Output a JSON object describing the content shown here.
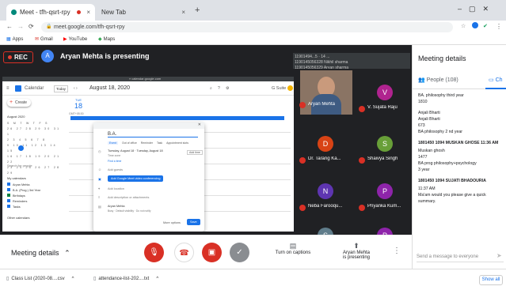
{
  "browser": {
    "tabs": [
      {
        "title": "Meet - tfh-qsrt-rpy",
        "close": "×"
      },
      {
        "title": "New Tab",
        "close": "×"
      }
    ],
    "new_tab": "+",
    "address": "meet.google.com/tfh-qsrt-rpy",
    "bookmarks": [
      "Apps",
      "Gmail",
      "YouTube",
      "Maps"
    ]
  },
  "meet": {
    "rec_label": "REC",
    "presenter_initial": "A",
    "presenter_text": "Aryan Mehta is presenting",
    "caption_overlay": "11901494...5 · 14 ...\n1190145056328 Nikhil sharma\n1190145056329 Aryan sharma",
    "shared_screen": {
      "browser_top": "» calendar.google.com",
      "app_name": "Calendar",
      "today_btn": "Today",
      "date_title": "August 18, 2020",
      "suite": "G Suite",
      "create_label": "Create",
      "mini_month": "August 2020",
      "day_label": "TUE",
      "day_num": "18",
      "timezone": "GMT+05:30",
      "search_people": "Search for people",
      "my_calendars_label": "My calendars",
      "my_calendars": [
        "Aryan Mehta",
        "B.A. (Prog.) 3rd Year",
        "Birthdays",
        "Reminders",
        "Tasks"
      ],
      "other_calendars_label": "Other calendars",
      "dialog": {
        "title": "B.A.",
        "tabs": [
          "Event",
          "Out of office",
          "Reminder",
          "Task",
          "Appointment slots"
        ],
        "date_line": "Tuesday, August 18  ·  Tuesday, August 18",
        "time_zone": "Time zone",
        "find_time": "Find a time",
        "add_guests": "Add guests",
        "meet_button": "Add Google Meet video conferencing",
        "add_location": "Add location",
        "add_description": "Add description or attachments",
        "owner": "Aryan Mehta",
        "owner_sub": "Busy · Default visibility · Do not notify",
        "more_options": "More options",
        "save": "Save"
      }
    },
    "participants": [
      {
        "name": "Aryan Mehta",
        "initial": "",
        "color": "#6b4a3a"
      },
      {
        "name": "V. Sujata Raju",
        "initial": "V",
        "color": "#b0238f"
      },
      {
        "name": "Dr. Tarang Ka...",
        "initial": "D",
        "color": "#d84315"
      },
      {
        "name": "Shaivya Singh",
        "initial": "S",
        "color": "#689f38"
      },
      {
        "name": "Neba Farooqu...",
        "initial": "N",
        "color": "#5e35b1"
      },
      {
        "name": "Priyanka Kum...",
        "initial": "P",
        "color": "#8e24aa"
      },
      {
        "name": "",
        "initial": "S",
        "color": "#607d8b"
      },
      {
        "name": "",
        "initial": "P",
        "color": "#8e24aa"
      }
    ]
  },
  "panel": {
    "title": "Meeting details",
    "people_tab": "People (108)",
    "chat_tab": "Ch",
    "messages": [
      {
        "sender": "",
        "lines": [
          "BA. philosophy third year",
          "1810"
        ]
      },
      {
        "sender": "",
        "lines": [
          "Anjali Bharti",
          "Anjali Bharti",
          "673",
          "BA philosophy 2 nd year"
        ]
      },
      {
        "sender": "1801450 1094 MUSKAN GHOSE 11:36 AM",
        "lines": [
          "Muskan ghosh",
          "1477",
          "BA prog philosophy+psychology",
          "3 year"
        ]
      },
      {
        "sender": "1801450 1094 SUJATI BHADOURIA",
        "lines": [
          "11:37 AM",
          "Ma'am would you please give a quick summary."
        ]
      }
    ],
    "send_placeholder": "Send a message to everyone"
  },
  "bottom": {
    "meeting_details": "Meeting details",
    "captions": "Turn on captions",
    "presenting_1": "Aryan Mehta",
    "presenting_2": "is presenting",
    "more": "⋮"
  },
  "downloads": [
    {
      "name": "Class List (2020-08....csv",
      "chev": "^"
    },
    {
      "name": "attendance-list-202....txt",
      "chev": "^"
    }
  ],
  "show_all": "Show all"
}
